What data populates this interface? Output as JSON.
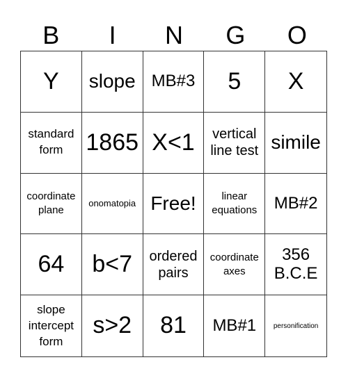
{
  "header": [
    "B",
    "I",
    "N",
    "G",
    "O"
  ],
  "cells": [
    [
      "Y",
      "slope",
      "MB#3",
      "5",
      "X"
    ],
    [
      "standard form",
      "1865",
      "X<1",
      "vertical line test",
      "simile"
    ],
    [
      "coordinate plane",
      "onomatopia",
      "Free!",
      "linear equations",
      "MB#2"
    ],
    [
      "64",
      "b<7",
      "ordered pairs",
      "coordinate axes",
      "356 B.C.E"
    ],
    [
      "slope intercept form",
      "s>2",
      "81",
      "MB#1",
      "personification"
    ]
  ]
}
